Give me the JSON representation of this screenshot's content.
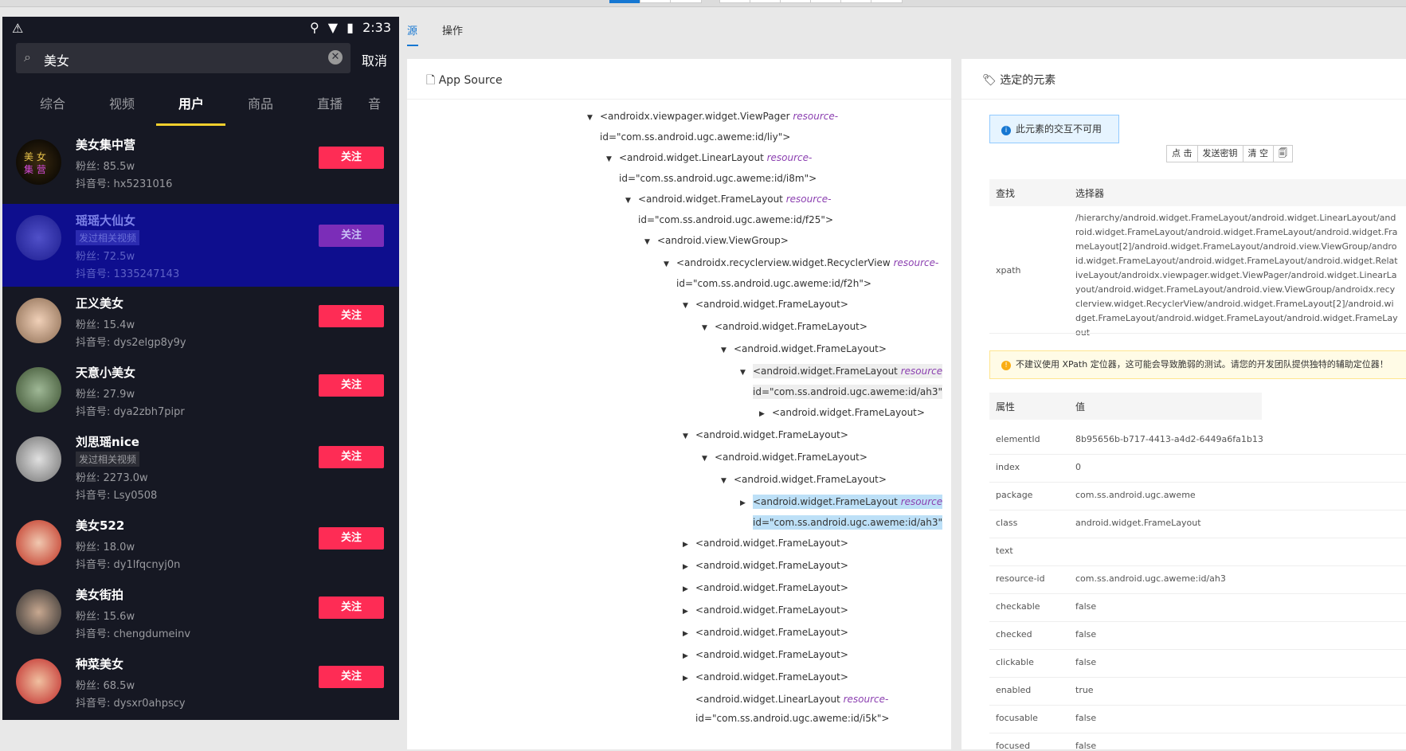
{
  "phone": {
    "status": {
      "time": "2:33"
    },
    "search": {
      "query": "美女",
      "cancel": "取消"
    },
    "tabs": [
      "综合",
      "视频",
      "用户",
      "商品",
      "直播",
      "音"
    ],
    "users": [
      {
        "name": "美女集中营",
        "fans": "粉丝: 85.5w",
        "uid": "抖音号: hx5231016",
        "follow": "关注"
      },
      {
        "name": "瑶瑶大仙女",
        "badge": "发过相关视频",
        "fans": "粉丝: 72.5w",
        "uid": "抖音号: 1335247143",
        "follow": "关注"
      },
      {
        "name": "正义美女",
        "fans": "粉丝: 15.4w",
        "uid": "抖音号: dys2elgp8y9y",
        "follow": "关注"
      },
      {
        "name": "天意小美女",
        "fans": "粉丝: 27.9w",
        "uid": "抖音号: dya2zbh7pipr",
        "follow": "关注"
      },
      {
        "name": "刘思瑶nice",
        "badge": "发过相关视频",
        "fans": "粉丝: 2273.0w",
        "uid": "抖音号: Lsy0508",
        "follow": "关注"
      },
      {
        "name": "美女522",
        "fans": "粉丝: 18.0w",
        "uid": "抖音号: dy1lfqcnyj0n",
        "follow": "关注"
      },
      {
        "name": "美女街拍",
        "fans": "粉丝: 15.6w",
        "uid": "抖音号: chengdumeinv",
        "follow": "关注"
      },
      {
        "name": "种菜美女",
        "fans": "粉丝: 68.5w",
        "uid": "抖音号: dysxr0ahpscy",
        "follow": "关注"
      }
    ]
  },
  "source_tabs": {
    "source": "源",
    "actions": "操作"
  },
  "app_source": {
    "title": "App Source",
    "nodes": [
      {
        "arrow": "▼",
        "tag": "<androidx.viewpager.widget.ViewPager",
        "attr": "resource-",
        "line2": "id=\"com.ss.android.ugc.aweme:id/liy\">"
      },
      {
        "arrow": "▼",
        "tag": "<android.widget.LinearLayout",
        "attr": "resource-",
        "line2": "id=\"com.ss.android.ugc.aweme:id/i8m\">"
      },
      {
        "arrow": "▼",
        "tag": "<android.widget.FrameLayout",
        "attr": "resource-",
        "line2": "id=\"com.ss.android.ugc.aweme:id/f25\">"
      },
      {
        "arrow": "▼",
        "tag": "<android.view.ViewGroup>"
      },
      {
        "arrow": "▼",
        "tag": "<androidx.recyclerview.widget.RecyclerView",
        "attr": "resource-",
        "line2": "id=\"com.ss.android.ugc.aweme:id/f2h\">"
      },
      {
        "arrow": "▼",
        "tag": "<android.widget.FrameLayout>"
      },
      {
        "arrow": "▼",
        "tag": "<android.widget.FrameLayout>"
      },
      {
        "arrow": "▼",
        "tag": "<android.widget.FrameLayout>"
      },
      {
        "arrow": "▼",
        "tag": "<android.widget.FrameLayout",
        "attr": "resource",
        "line2": "id=\"com.ss.android.ugc.aweme:id/ah3\""
      },
      {
        "arrow": "▶",
        "tag": "<android.widget.FrameLayout>"
      },
      {
        "arrow": "▼",
        "tag": "<android.widget.FrameLayout>"
      },
      {
        "arrow": "▼",
        "tag": "<android.widget.FrameLayout>"
      },
      {
        "arrow": "▼",
        "tag": "<android.widget.FrameLayout>"
      },
      {
        "arrow": "▶",
        "tag": "<android.widget.FrameLayout",
        "attr": "resource",
        "line2": "id=\"com.ss.android.ugc.aweme:id/ah3\""
      },
      {
        "arrow": "▶",
        "tag": "<android.widget.FrameLayout>"
      },
      {
        "arrow": "▶",
        "tag": "<android.widget.FrameLayout>"
      },
      {
        "arrow": "▶",
        "tag": "<android.widget.FrameLayout>"
      },
      {
        "arrow": "▶",
        "tag": "<android.widget.FrameLayout>"
      },
      {
        "arrow": "▶",
        "tag": "<android.widget.FrameLayout>"
      },
      {
        "arrow": "▶",
        "tag": "<android.widget.FrameLayout>"
      },
      {
        "arrow": "▶",
        "tag": "<android.widget.FrameLayout>"
      },
      {
        "arrow": "",
        "tag": "<android.widget.LinearLayout",
        "attr": "resource-",
        "line2": "id=\"com.ss.android.ugc.aweme:id/i5k\">"
      }
    ]
  },
  "selected": {
    "title": "选定的元素",
    "info": "此元素的交互不可用",
    "buttons": [
      "点 击",
      "发送密钥",
      "清 空",
      "🗐"
    ],
    "find_header": "查找",
    "selector_header": "选择器",
    "xpath_label": "xpath",
    "xpath_value": "/hierarchy/android.widget.FrameLayout/android.widget.LinearLayout/android.widget.FrameLayout/android.widget.FrameLayout/android.widget.FrameLayout[2]/android.widget.FrameLayout/android.view.ViewGroup/android.widget.FrameLayout/android.widget.FrameLayout/android.widget.RelativeLayout/androidx.viewpager.widget.ViewPager/android.widget.LinearLayout/android.widget.FrameLayout/android.view.ViewGroup/androidx.recyclerview.widget.RecyclerView/android.widget.FrameLayout[2]/android.widget.FrameLayout/android.widget.FrameLayout/android.widget.FrameLayout",
    "warning": "不建议使用 XPath 定位器，这可能会导致脆弱的测试。请您的开发团队提供独特的辅助定位器！",
    "attr_header": "属性",
    "value_header": "值",
    "attributes": [
      {
        "k": "elementId",
        "v": "8b95656b-b717-4413-a4d2-6449a6fa1b13"
      },
      {
        "k": "index",
        "v": "0"
      },
      {
        "k": "package",
        "v": "com.ss.android.ugc.aweme"
      },
      {
        "k": "class",
        "v": "android.widget.FrameLayout"
      },
      {
        "k": "text",
        "v": ""
      },
      {
        "k": "resource-id",
        "v": "com.ss.android.ugc.aweme:id/ah3"
      },
      {
        "k": "checkable",
        "v": "false"
      },
      {
        "k": "checked",
        "v": "false"
      },
      {
        "k": "clickable",
        "v": "false"
      },
      {
        "k": "enabled",
        "v": "true"
      },
      {
        "k": "focusable",
        "v": "false"
      },
      {
        "k": "focused",
        "v": "false"
      }
    ]
  }
}
